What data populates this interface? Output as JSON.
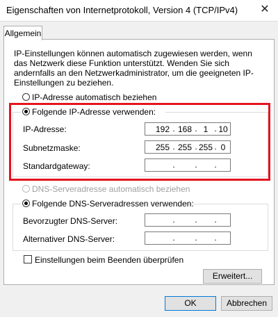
{
  "window": {
    "title": "Eigenschaften von Internetprotokoll, Version 4 (TCP/IPv4)"
  },
  "tabs": [
    {
      "label": "Allgemein"
    }
  ],
  "description": "IP-Einstellungen können automatisch zugewiesen werden, wenn das Netzwerk diese Funktion unterstützt. Wenden Sie sich andernfalls an den Netzwerkadministrator, um die geeigneten IP-Einstellungen zu beziehen.",
  "ip": {
    "auto_label": "IP-Adresse automatisch beziehen",
    "manual_label": "Folgende IP-Adresse verwenden:",
    "fields": [
      {
        "label": "IP-Adresse:",
        "octets": [
          "192",
          "168",
          "1",
          "10"
        ]
      },
      {
        "label": "Subnetzmaske:",
        "octets": [
          "255",
          "255",
          "255",
          "0"
        ]
      },
      {
        "label": "Standardgateway:",
        "octets": [
          "",
          "",
          "",
          ""
        ]
      }
    ]
  },
  "dns": {
    "auto_label": "DNS-Serveradresse automatisch beziehen",
    "manual_label": "Folgende DNS-Serveradressen verwenden:",
    "fields": [
      {
        "label": "Bevorzugter DNS-Server:",
        "octets": [
          "",
          "",
          "",
          ""
        ]
      },
      {
        "label": "Alternativer DNS-Server:",
        "octets": [
          "",
          "",
          "",
          ""
        ]
      }
    ]
  },
  "validate_label": "Einstellungen beim Beenden überprüfen",
  "buttons": {
    "advanced": "Erweitert...",
    "ok": "OK",
    "cancel": "Abbrechen"
  },
  "icons": {
    "close": "close-icon"
  },
  "colors": {
    "highlight": "#e4141e",
    "focus": "#0078d7"
  }
}
